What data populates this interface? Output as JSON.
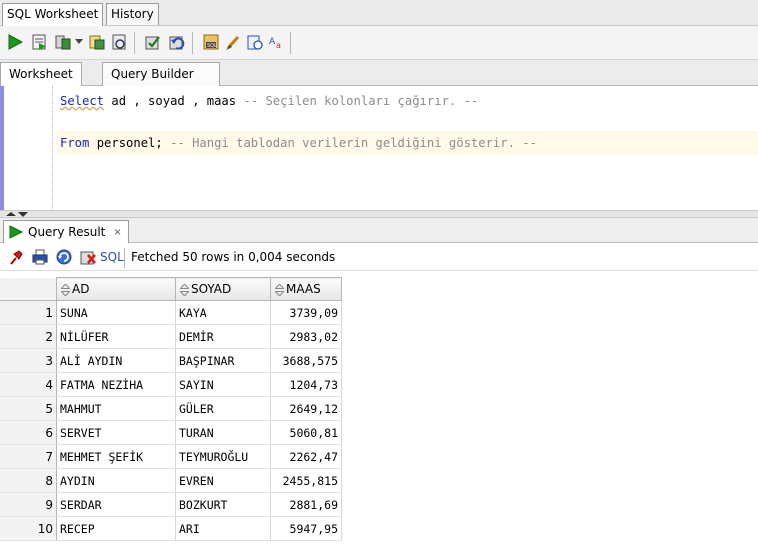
{
  "top_tabs": [
    "SQL Worksheet",
    "History"
  ],
  "editor_tabs": [
    "Worksheet",
    "Query Builder"
  ],
  "code": {
    "line1": {
      "kw": "Select",
      "rest": " ad , soyad , maas ",
      "comment": "-- Seçilen kolonları çağırır. --"
    },
    "line2": {
      "kw": "From",
      "rest": " personel; ",
      "comment": "-- Hangi tablodan verilerin geldiğini gösterir. --"
    }
  },
  "result_tab": {
    "label": "Query Result",
    "close": "×"
  },
  "result_toolbar": {
    "sql_label": "SQL",
    "status": "Fetched 50 rows in 0,004 seconds"
  },
  "grid": {
    "columns": [
      "AD",
      "SOYAD",
      "MAAS"
    ],
    "rows": [
      {
        "n": "1",
        "ad": "SUNA",
        "soyad": "KAYA",
        "maas": "3739,09"
      },
      {
        "n": "2",
        "ad": "NİLÜFER",
        "soyad": "DEMİR",
        "maas": "2983,02"
      },
      {
        "n": "3",
        "ad": "ALİ AYDIN",
        "soyad": "BAŞPINAR",
        "maas": "3688,575"
      },
      {
        "n": "4",
        "ad": "FATMA NEZİHA",
        "soyad": "SAYIN",
        "maas": "1204,73"
      },
      {
        "n": "5",
        "ad": "MAHMUT",
        "soyad": "GÜLER",
        "maas": "2649,12"
      },
      {
        "n": "6",
        "ad": "SERVET",
        "soyad": "TURAN",
        "maas": "5060,81"
      },
      {
        "n": "7",
        "ad": "MEHMET ŞEFİK",
        "soyad": "TEYMUROĞLU",
        "maas": "2262,47"
      },
      {
        "n": "8",
        "ad": "AYDIN",
        "soyad": "EVREN",
        "maas": "2455,815"
      },
      {
        "n": "9",
        "ad": "SERDAR",
        "soyad": "BOZKURT",
        "maas": "2881,69"
      },
      {
        "n": "10",
        "ad": "RECEP",
        "soyad": "ARI",
        "maas": "5947,95"
      }
    ]
  },
  "colors": {
    "keyword": "#1d24b6",
    "comment": "#8c8c8c",
    "run_green": "#1a9a1a",
    "editor_margin": "#8a8fe0"
  },
  "toolbar_icons": [
    "run-statement-icon",
    "run-script-icon",
    "autotrace-icon",
    "commit-icon",
    "rollback-icon",
    "sql-tuning-icon",
    "clear-icon",
    "sql-history-icon",
    "format-icon",
    "case-toggle-icon"
  ],
  "result_toolbar_icons": [
    "pin-icon",
    "print-icon",
    "refresh-icon",
    "delete-icon"
  ]
}
